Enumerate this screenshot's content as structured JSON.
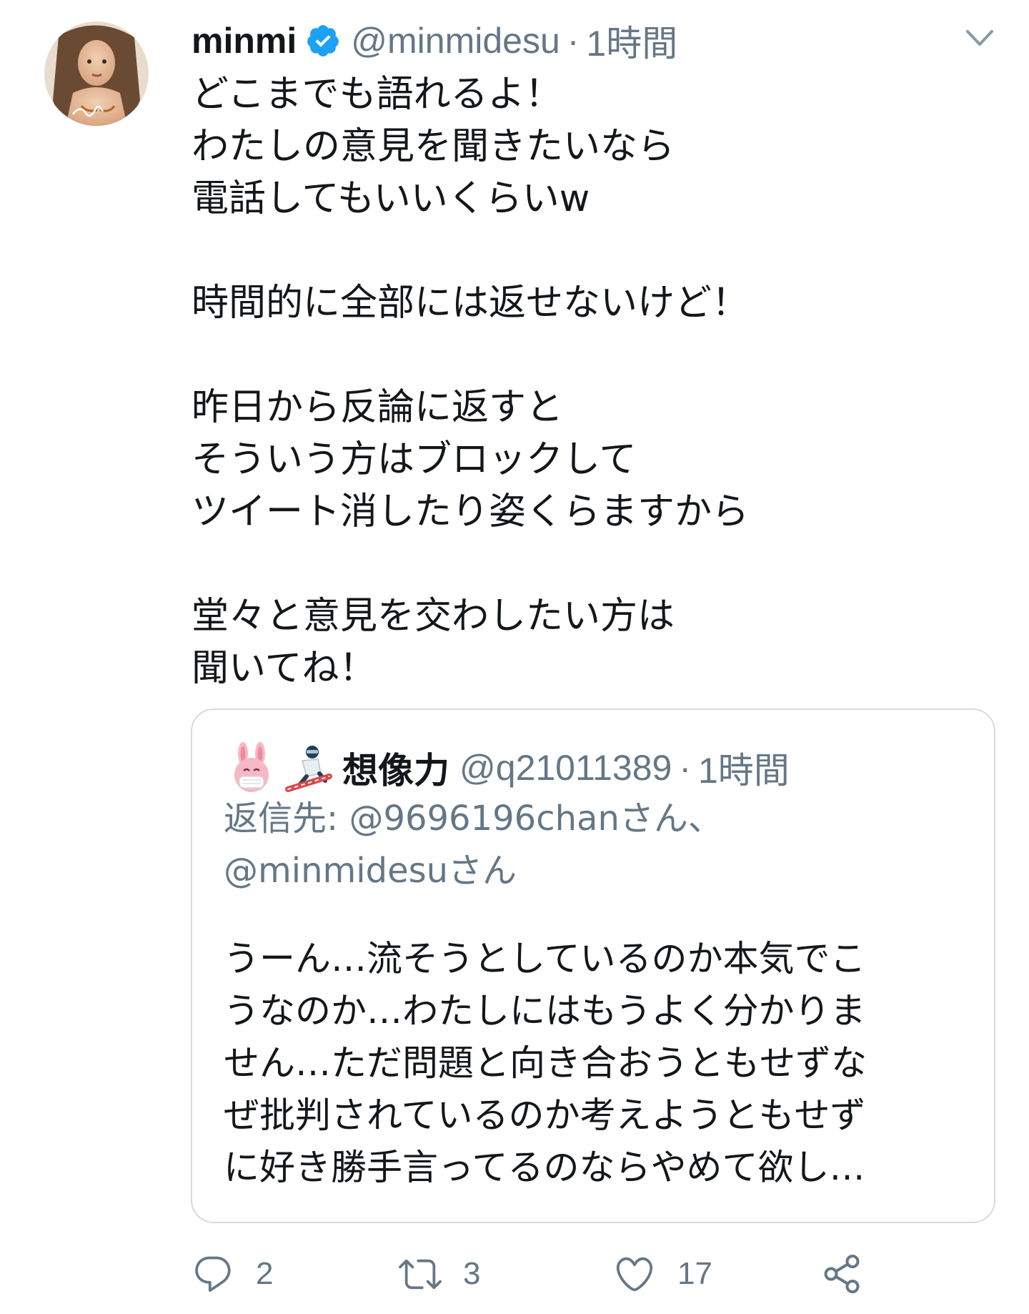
{
  "tweet": {
    "display_name": "minmi",
    "verified_icon": "verified-badge-icon",
    "handle": "@minmidesu",
    "separator": "·",
    "time": "1時間",
    "body_lines": [
      "どこまでも語れるよ！",
      "わたしの意見を聞きたいなら",
      "電話してもいいくらいw",
      "",
      "時間的に全部には返せないけど！",
      "",
      "昨日から反論に返すと",
      "そういう方はブロックして",
      "ツイート消したり姿くらますから",
      "",
      "堂々と意見を交わしたい方は",
      "聞いてね！"
    ]
  },
  "quote": {
    "emoji_1": "rabbit-mask-emoji",
    "emoji_2": "snowboarder-emoji",
    "display_name": "想像力",
    "handle": "@q21011389",
    "separator": "·",
    "time": "1時間",
    "reply_prefix": "返信先: ",
    "reply_mention_1": "@9696196chan",
    "reply_suffix_1": "さん、",
    "reply_mention_2": "@minmidesu",
    "reply_suffix_2": "さん",
    "text_lines": [
      "うーん…流そうとしているのか本気でこ",
      "うなのか…わたしにはもうよく分かりま",
      "せん…ただ問題と向き合おうともせずな",
      "ぜ批判されているのか考えようともせず",
      "に好き勝手言ってるのならやめて欲し…"
    ]
  },
  "actions": {
    "reply_count": "2",
    "retweet_count": "3",
    "like_count": "17"
  },
  "colors": {
    "text": "#14171a",
    "secondary": "#657786",
    "verified": "#1da1f2",
    "border": "#d4dbe0"
  }
}
